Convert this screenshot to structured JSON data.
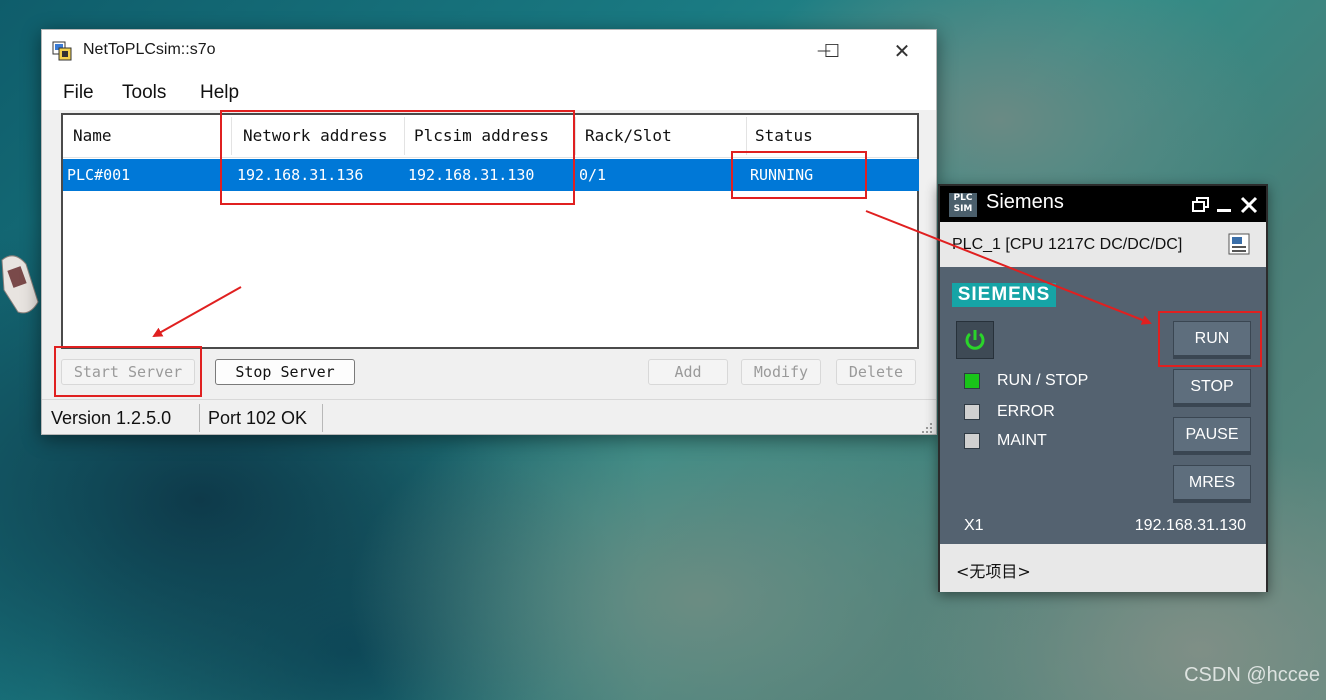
{
  "main_window": {
    "title": "NetToPLCsim::s7o",
    "window_controls": {
      "minimize": "—",
      "maximize": "☐",
      "close": "✕"
    },
    "menu": [
      "File",
      "Tools",
      "Help"
    ],
    "columns": [
      "Name",
      "Network address",
      "Plcsim address",
      "Rack/Slot",
      "Status"
    ],
    "rows": [
      {
        "name": "PLC#001",
        "network_address": "192.168.31.136",
        "plcsim_address": "192.168.31.130",
        "rack_slot": "0/1",
        "status": "RUNNING",
        "selected": true
      }
    ],
    "buttons": {
      "start_server": "Start Server",
      "stop_server": "Stop Server",
      "add": "Add",
      "modify": "Modify",
      "delete": "Delete"
    },
    "status": {
      "version": "Version 1.2.5.0",
      "port": "Port 102 OK"
    }
  },
  "plcsim": {
    "logo": "PLC SIM",
    "title": "Siemens",
    "cpu": "PLC_1 [CPU 1217C DC/DC/DC]",
    "brand": "SIEMENS",
    "leds": [
      {
        "label": "RUN / STOP",
        "color": "#19c419"
      },
      {
        "label": "ERROR",
        "color": "#d0d0d0"
      },
      {
        "label": "MAINT",
        "color": "#d0d0d0"
      }
    ],
    "buttons": [
      "RUN",
      "STOP",
      "PAUSE",
      "MRES"
    ],
    "interface": "X1",
    "ip": "192.168.31.130",
    "project": "<无项目>"
  },
  "watermark": "CSDN @hccee",
  "colors": {
    "selection": "#0078d7",
    "annotation_red": "#e02020",
    "plcsim_body": "#546270",
    "siemens_teal": "#16a4a6"
  }
}
